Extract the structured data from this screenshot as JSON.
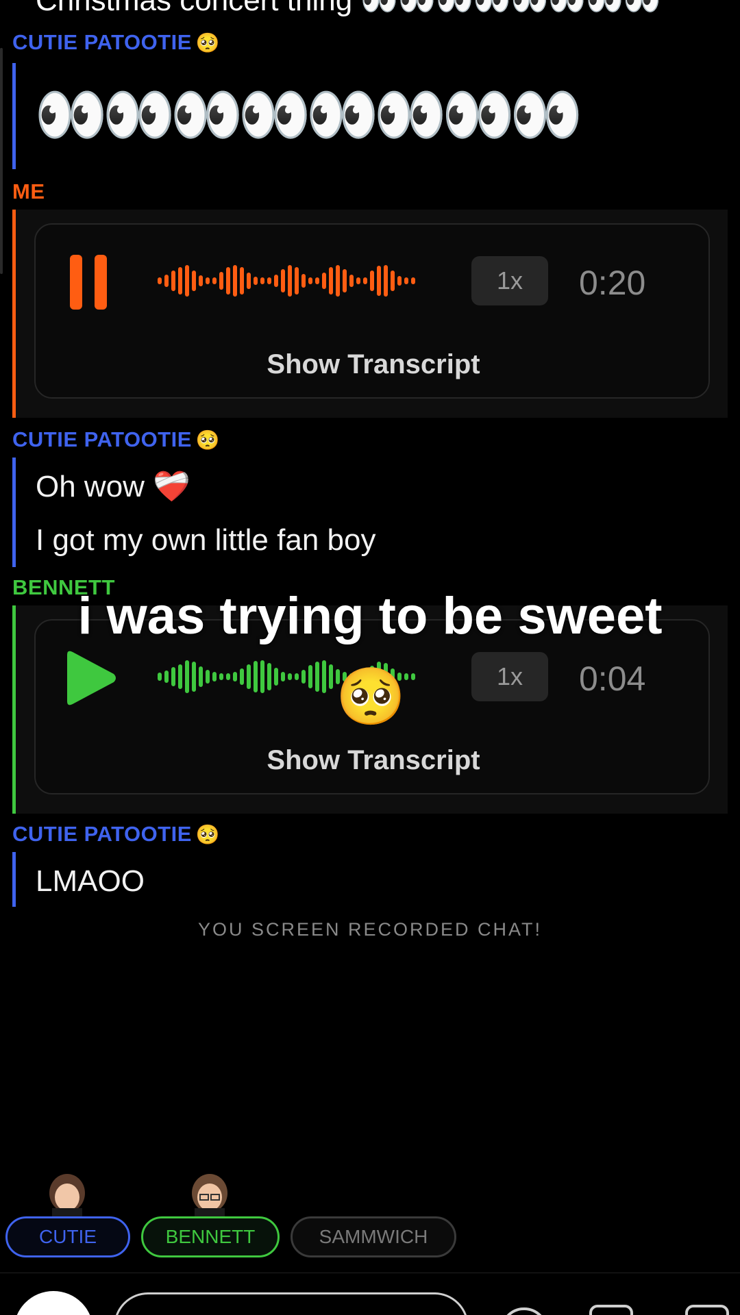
{
  "top_partial_text": "Christmas concert thing 👀👀👀👀👀👀👀👀",
  "messages": {
    "m1_sender": "CUTIE PATOOTIE",
    "m1_sender_emoji": "🥺",
    "m1_content": "👀👀👀👀👀👀👀👀",
    "m2_sender": "ME",
    "m2_voice": {
      "speed": "1x",
      "duration": "0:20",
      "transcript": "Show Transcript",
      "state": "playing"
    },
    "m3_sender": "CUTIE PATOOTIE",
    "m3_sender_emoji": "🥺",
    "m3_line1": "Oh wow",
    "m3_line1_emoji": "❤️‍🩹",
    "m3_line2": "I got my own little fan boy",
    "m4_sender": "BENNETT",
    "m4_voice": {
      "speed": "1x",
      "duration": "0:04",
      "transcript": "Show Transcript",
      "state": "paused"
    },
    "m5_sender": "CUTIE PATOOTIE",
    "m5_sender_emoji": "🥺",
    "m5_content": "LMAOO"
  },
  "overlay_caption": "i was trying to be sweet",
  "overlay_emoji": "🥺",
  "notice": "YOU SCREEN RECORDED CHAT!",
  "participants": [
    "CUTIE",
    "BENNETT",
    "SAMMWICH"
  ],
  "colors": {
    "cutie": "#3f63ee",
    "me": "#ff5d12",
    "bennett": "#3fc83f",
    "background": "#000000"
  }
}
